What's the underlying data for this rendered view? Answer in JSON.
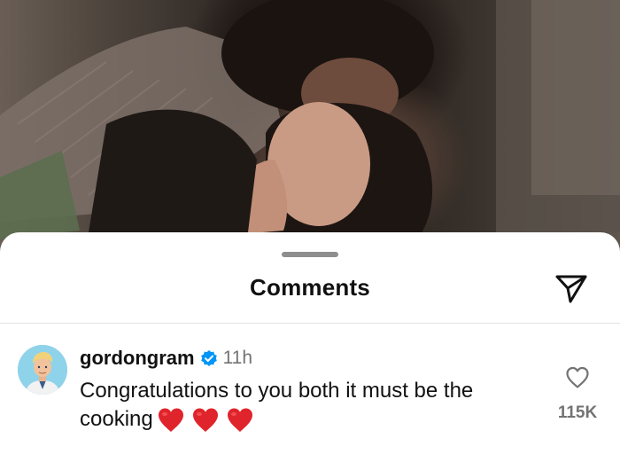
{
  "sheet": {
    "title": "Comments",
    "share_icon": "paper-plane-icon"
  },
  "comment": {
    "username": "gordongram",
    "verified_icon": "verified-badge-icon",
    "time": "11h",
    "text": "Congratulations to you both it must be the cooking",
    "emoji": [
      "red-heart",
      "red-heart",
      "red-heart"
    ],
    "like_icon": "heart-outline-icon",
    "like_count": "115K"
  },
  "colors": {
    "verified": "#0095f6",
    "heart": "#e0242b",
    "muted_text": "#737373"
  }
}
